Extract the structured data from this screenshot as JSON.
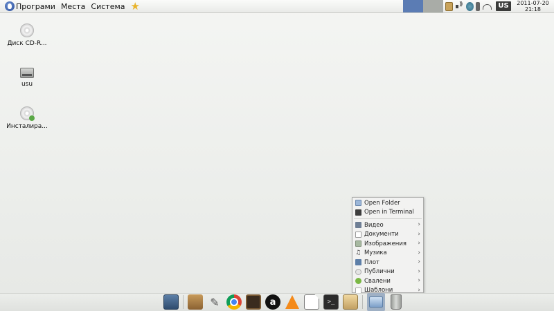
{
  "top_panel": {
    "menu": {
      "applications": "Програми",
      "places": "Места",
      "system": "Система"
    },
    "workspaces": [
      {
        "name": "workspace-1",
        "active": true
      },
      {
        "name": "workspace-2",
        "active": false
      }
    ],
    "tray_icons": [
      "clipboard-icon",
      "volume-icon",
      "update-icon",
      "battery-icon",
      "wifi-icon"
    ],
    "keyboard_layout": "US",
    "clock": {
      "date": "2011-07-20",
      "time": "21:18"
    }
  },
  "desktop": {
    "icons": [
      {
        "label": "Диск CD-R...",
        "icon": "cd-icon"
      },
      {
        "label": "usu",
        "icon": "hard-drive-icon"
      },
      {
        "label": "Инсталира...",
        "icon": "installer-disc-icon"
      }
    ]
  },
  "context_menu": {
    "actions": [
      {
        "label": "Open Folder",
        "icon": "folder-icon"
      },
      {
        "label": "Open in Terminal",
        "icon": "terminal-icon"
      }
    ],
    "folders": [
      {
        "label": "Видео",
        "icon": "video-icon"
      },
      {
        "label": "Документи",
        "icon": "document-icon"
      },
      {
        "label": "Изображения",
        "icon": "image-icon"
      },
      {
        "label": "Музика",
        "icon": "music-icon"
      },
      {
        "label": "Плот",
        "icon": "desktop-icon"
      },
      {
        "label": "Публични",
        "icon": "public-icon"
      },
      {
        "label": "Свалени",
        "icon": "download-icon"
      },
      {
        "label": "Шаблони",
        "icon": "template-icon"
      }
    ]
  },
  "dock": {
    "items": [
      "show-desktop-icon",
      "archive-manager-icon",
      "gimp-icon",
      "chrome-icon",
      "video-player-icon",
      "amazon-icon",
      "vlc-icon",
      "libreoffice-icon",
      "terminal-icon",
      "drive-icon",
      "folder-icon",
      "trash-icon"
    ],
    "terminal_glyph": ">_",
    "amazon_glyph": "a"
  },
  "colors": {
    "workspace_active": "#5b7cb4",
    "workspace_inactive": "#a9aca7",
    "desktop_bg": "#eceeeb"
  }
}
